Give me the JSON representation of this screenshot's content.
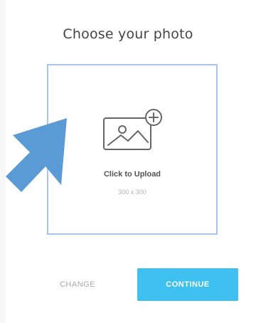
{
  "dialog": {
    "title": "Choose your photo"
  },
  "upload": {
    "label": "Click to Upload",
    "size_hint": "300 x 300",
    "icon": "image-add-icon"
  },
  "pointer": {
    "icon": "pointer-arrow-icon",
    "color": "#5b9bd5"
  },
  "actions": {
    "change_label": "CHANGE",
    "continue_label": "CONTINUE"
  },
  "colors": {
    "accent": "#3ec0f1",
    "drop_zone_border": "#a9c4ec"
  }
}
